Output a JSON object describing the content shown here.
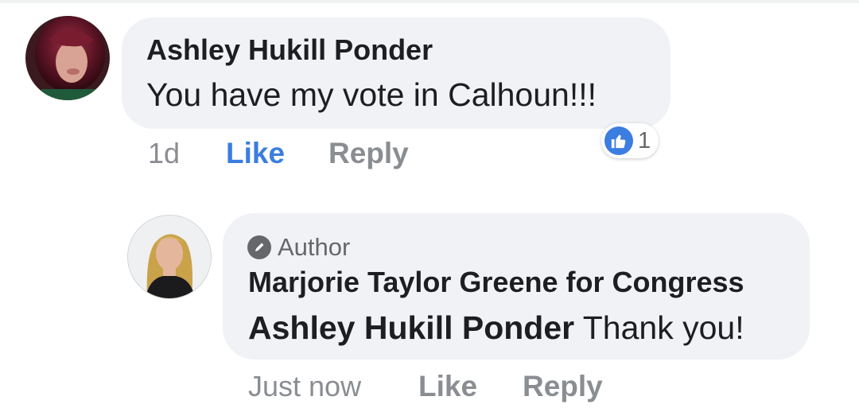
{
  "comment": {
    "author": "Ashley Hukill Ponder",
    "text": "You have my vote in Calhoun!!!",
    "timestamp": "1d",
    "like_label": "Like",
    "reply_label": "Reply",
    "reaction_count": "1",
    "reaction_icon": "thumbs-up-icon",
    "like_active_color": "#3b7de0"
  },
  "reply": {
    "badge_label": "Author",
    "badge_icon": "pencil-icon",
    "author": "Marjorie Taylor Greene for Congress",
    "mention": "Ashley Hukill Ponder",
    "text": " Thank you!",
    "timestamp": "Just now",
    "like_label": "Like",
    "reply_label": "Reply"
  }
}
